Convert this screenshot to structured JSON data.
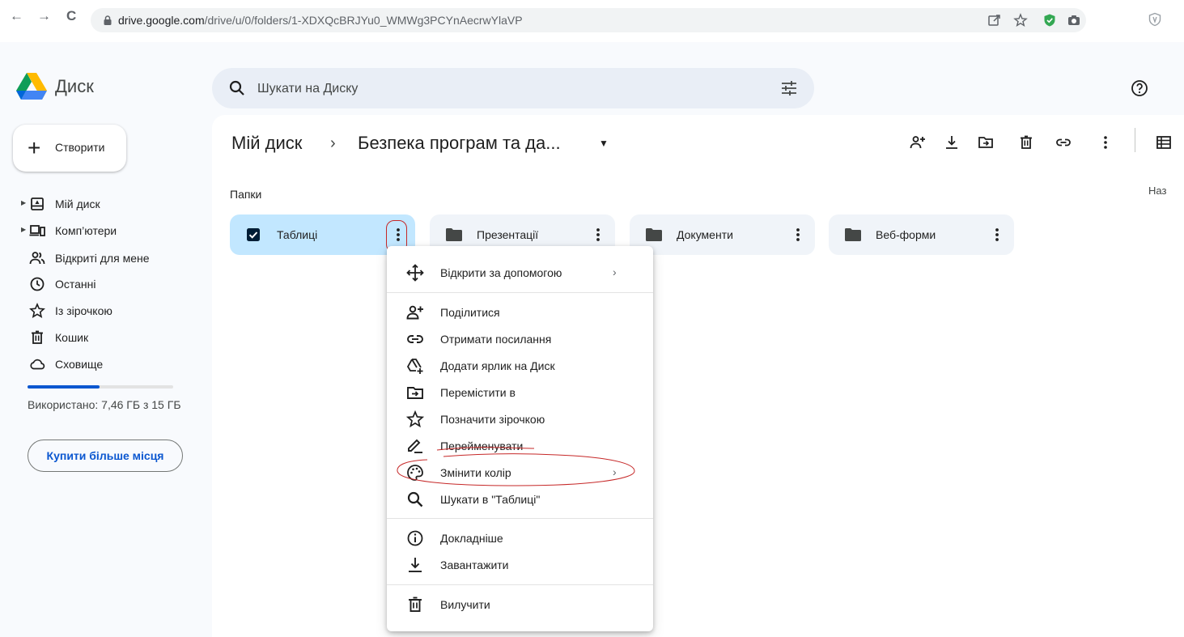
{
  "browser": {
    "url_host": "drive.google.com",
    "url_path": "/drive/u/0/folders/1-XDXQcBRJYu0_WMWg3PCYnAecrwYlaVP",
    "nav_back": "←",
    "nav_forward": "→",
    "nav_reload": "C"
  },
  "header": {
    "app_name": "Диск",
    "search_placeholder": "Шукати на Диску"
  },
  "sidebar": {
    "create_label": "Створити",
    "create_plus": "+",
    "items": [
      {
        "label": "Мій диск",
        "icon": "my-drive-icon"
      },
      {
        "label": "Комп’ютери",
        "icon": "computers-icon"
      },
      {
        "label": "Відкриті для мене",
        "icon": "shared-with-me-icon"
      },
      {
        "label": "Останні",
        "icon": "recent-icon"
      },
      {
        "label": "Із зірочкою",
        "icon": "star-icon"
      },
      {
        "label": "Кошик",
        "icon": "trash-icon"
      },
      {
        "label": "Сховище",
        "icon": "cloud-icon"
      }
    ],
    "storage_used_fraction": 0.497,
    "storage_text": "Використано: 7,46 ГБ з 15 ГБ",
    "buy_label": "Купити більше місця"
  },
  "main": {
    "breadcrumb_root": "Мій диск",
    "breadcrumb_sep": "›",
    "breadcrumb_current": "Безпека програм та да...",
    "breadcrumb_caret": "▼",
    "section_title": "Папки",
    "sort_label": "Наз",
    "folders": [
      {
        "name": "Таблиці",
        "selected": true
      },
      {
        "name": "Презентації",
        "selected": false
      },
      {
        "name": "Документи",
        "selected": false
      },
      {
        "name": "Веб-форми",
        "selected": false
      }
    ]
  },
  "context_menu": {
    "items": [
      {
        "label": "Відкрити за допомогою",
        "icon": "open-with-icon",
        "submenu": true
      },
      {
        "label": "Поділитися",
        "icon": "share-icon"
      },
      {
        "label": "Отримати посилання",
        "icon": "link-icon"
      },
      {
        "label": "Додати ярлик на Диск",
        "icon": "add-shortcut-icon"
      },
      {
        "label": "Перемістити в",
        "icon": "move-icon"
      },
      {
        "label": "Позначити зірочкою",
        "icon": "star-icon"
      },
      {
        "label": "Перейменувати",
        "icon": "rename-icon"
      },
      {
        "label": "Змінити колір",
        "icon": "palette-icon",
        "submenu": true
      },
      {
        "label": "Шукати в \"Таблиці\"",
        "icon": "search-icon"
      },
      {
        "label": "Докладніше",
        "icon": "info-icon"
      },
      {
        "label": "Завантажити",
        "icon": "download-icon"
      },
      {
        "label": "Вилучити",
        "icon": "trash-icon"
      }
    ],
    "chevron": "›"
  },
  "colors": {
    "accent": "#0b57d0",
    "selected_folder": "#c2e7ff",
    "annotation": "#c62828"
  }
}
